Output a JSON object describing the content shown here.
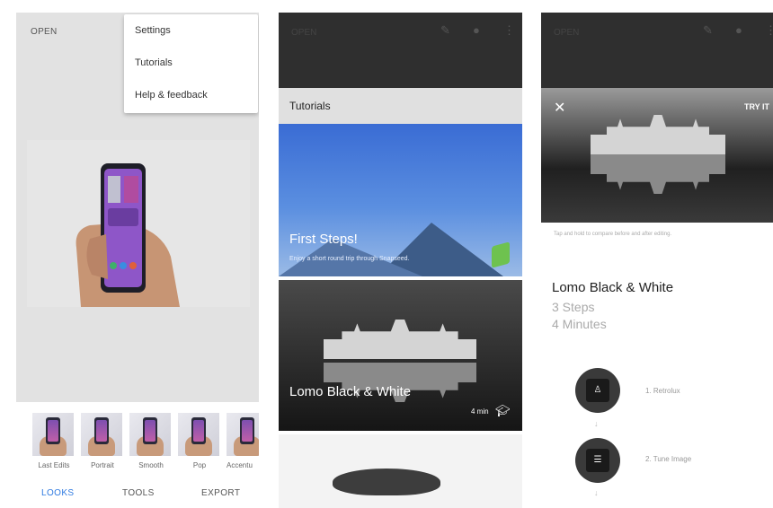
{
  "panel1": {
    "open_label": "OPEN",
    "menu": [
      "Settings",
      "Tutorials",
      "Help & feedback"
    ],
    "looks": [
      "Last Edits",
      "Portrait",
      "Smooth",
      "Pop",
      "Accentu"
    ],
    "tabs": {
      "looks": "LOOKS",
      "tools": "TOOLS",
      "export": "EXPORT"
    },
    "accent_color": "#2f7ae0"
  },
  "panel2": {
    "open_label": "OPEN",
    "header": "Tutorials",
    "cards": [
      {
        "title": "First Steps!",
        "subtitle": "Enjoy a short round trip through Snapseed."
      },
      {
        "title": "Lomo Black & White",
        "duration": "4 min"
      }
    ]
  },
  "panel3": {
    "open_label": "OPEN",
    "try_label": "TRY IT",
    "hint": "Tap and hold to compare before and after editing.",
    "title": "Lomo Black & White",
    "steps_count": "3 Steps",
    "minutes": "4 Minutes",
    "steps": [
      "1. Retrolux",
      "2. Tune Image"
    ]
  }
}
